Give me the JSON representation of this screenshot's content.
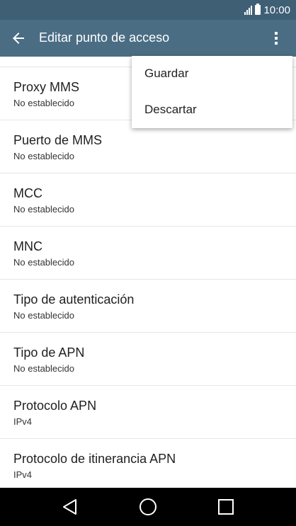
{
  "status_bar": {
    "time": "10:00",
    "icons": [
      "signal-icon",
      "battery-icon"
    ]
  },
  "toolbar": {
    "title": "Editar punto de acceso",
    "back_icon": "arrow-left-icon",
    "overflow_icon": "more-vert-icon"
  },
  "list": {
    "items": [
      {
        "title": "Proxy MMS",
        "summary": "No establecido"
      },
      {
        "title": "Puerto de MMS",
        "summary": "No establecido"
      },
      {
        "title": "MCC",
        "summary": "No establecido"
      },
      {
        "title": "MNC",
        "summary": "No establecido"
      },
      {
        "title": "Tipo de autenticación",
        "summary": "No establecido"
      },
      {
        "title": "Tipo de APN",
        "summary": "No establecido"
      },
      {
        "title": "Protocolo APN",
        "summary": "IPv4"
      },
      {
        "title": "Protocolo de itinerancia APN",
        "summary": "IPv4"
      }
    ]
  },
  "menu": {
    "items": [
      {
        "label": "Guardar"
      },
      {
        "label": "Descartar"
      }
    ]
  },
  "nav_bar": {
    "icons": [
      "back-triangle-icon",
      "home-circle-icon",
      "recents-square-icon"
    ]
  },
  "colors": {
    "status_bar": "#3f5f75",
    "toolbar": "#4a6d84",
    "nav_bar": "#000000"
  }
}
